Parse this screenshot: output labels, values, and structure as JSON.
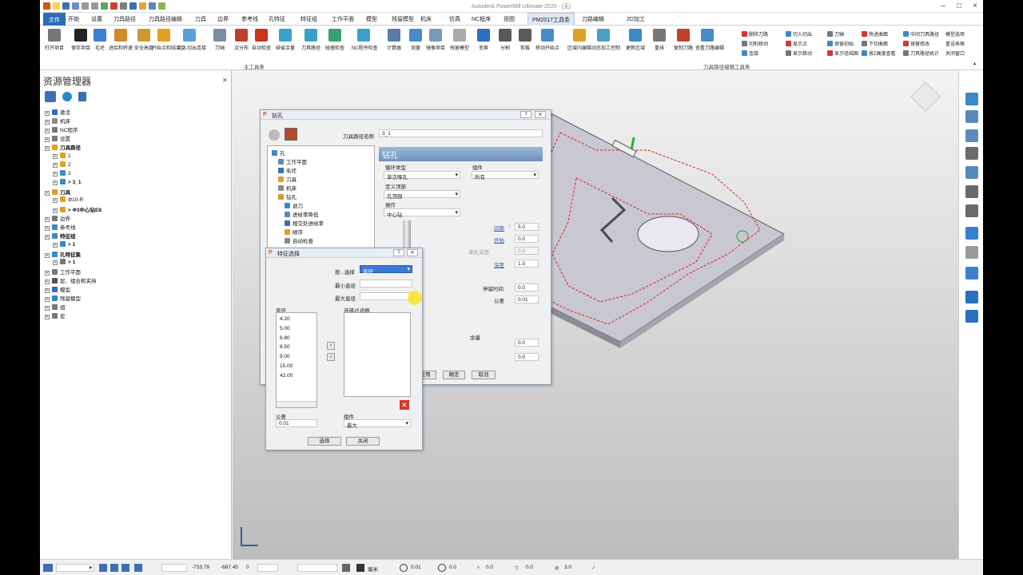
{
  "app": {
    "title": "Autodesk PowerMill Ultimate 2020 - (无)"
  },
  "menu": {
    "tabs": [
      "文件",
      "开始",
      "设置",
      "刀具路径",
      "刀具路径编辑",
      "刀具",
      "边界",
      "参考线",
      "孔特征",
      "特征组",
      "工作平面",
      "模型",
      "残留模型",
      "机床",
      "仿真",
      "NC程序",
      "视图",
      "PM2017工具条",
      "刀路编辑",
      "2D加工"
    ],
    "active": "PM2017工具条"
  },
  "ribbon": {
    "buttons": [
      "打开项目",
      "保存项目",
      "毛坯",
      "进给和转速",
      "安全高度",
      "开始点和结束点",
      "切入切出连接",
      "刀轴",
      "点分布",
      "自动检查",
      "缺省余量",
      "刀具路径",
      "碰撞检查",
      "NC程序检查",
      "计算器",
      "测量",
      "镜像项目",
      "残留模型",
      "变换",
      "分割",
      "剪裁",
      "移动开始点",
      "区域内编辑",
      "动态加工控制",
      "更新区域",
      "重排",
      "复制刀路",
      "查看刀路编辑"
    ],
    "small": [
      "删除刀路",
      "切入切出",
      "刀轴",
      "快进曲面",
      "中间刀具路径",
      "切削移动",
      "显示点",
      "保留初始",
      "下切曲面",
      "保留修改",
      "连接",
      "显示移动",
      "显示径结图",
      "按Z高度查看",
      "刀具路径统计"
    ],
    "right": [
      "模型选项",
      "重设表格",
      "关闭窗口"
    ],
    "groups": [
      "主工具条",
      "刀具路径编辑工具条"
    ]
  },
  "explorer": {
    "title": "资源管理器",
    "items": [
      "激活",
      "机床",
      "NC程序",
      "设置",
      "刀具路径",
      "1",
      "2",
      "3",
      "> 3_1",
      "刀具",
      "Φ10-R",
      "> Φ3中心钻E8",
      "边界",
      "参考线",
      "特征组",
      "> 1",
      "孔特征集",
      "> 1",
      "工作平面",
      "层、组合和夹持",
      "模型",
      "残留模型",
      "组",
      "宏"
    ]
  },
  "drill": {
    "title": "钻孔",
    "name_label": "刀具路径名称",
    "name_value": "3_1",
    "header": "钻孔",
    "tree": [
      "孔",
      "工作平面",
      "毛坯",
      "刀具",
      "机床",
      "钻孔",
      "退刀",
      "进给率降低",
      "相交处进给率",
      "顺序",
      "自动检查"
    ],
    "cycle_label": "循环类型",
    "cycle_value": "单次啄孔",
    "group_label": "组件",
    "group_value": "所有",
    "top_label": "定义顶部",
    "top_value": "孔顶部",
    "op_label": "操作",
    "op_value": "中心钻",
    "gap_label": "间隙",
    "gap_value": "5.0",
    "start_label": "开始",
    "start_value": "0.0",
    "pitch_label": "单孔深度",
    "pitch_value": "0.3",
    "depth_label": "深度",
    "depth_value": "1.5",
    "dwell_label": "停留时间",
    "dwell_value": "0.0",
    "tol_label": "公差",
    "tol_value": "0.01",
    "allow_label": "余量",
    "allow1": "0.0",
    "allow2": "0.0",
    "apply": "应用",
    "ok": "确定",
    "cancel": "取消"
  },
  "feature": {
    "title": "特征选择",
    "by_label": "按...选择",
    "by_value": "直径",
    "min_label": "最小直径",
    "max_label": "最大直径",
    "diam_label": "直径",
    "diameters": [
      "4.20",
      "5.00",
      "6.80",
      "8.50",
      "9.00",
      "15.00",
      "42.00"
    ],
    "filter_label": "选择过滤器",
    "tol_label": "公差",
    "tol_value": "0.01",
    "comp_label": "组件",
    "comp_value": "最大",
    "select": "选择",
    "close": "关闭"
  },
  "status": {
    "x": "-733.79",
    "y": "-687.45",
    "z": "0",
    "unit": "毫米",
    "tol": "0.01",
    "v1": "0.0",
    "v2": "0.0",
    "v3": "0.0",
    "v4": "3.0"
  },
  "colors": {
    "accent": "#2b6db8",
    "toolpath": "#e0201a",
    "part": "#c9c7d2"
  }
}
